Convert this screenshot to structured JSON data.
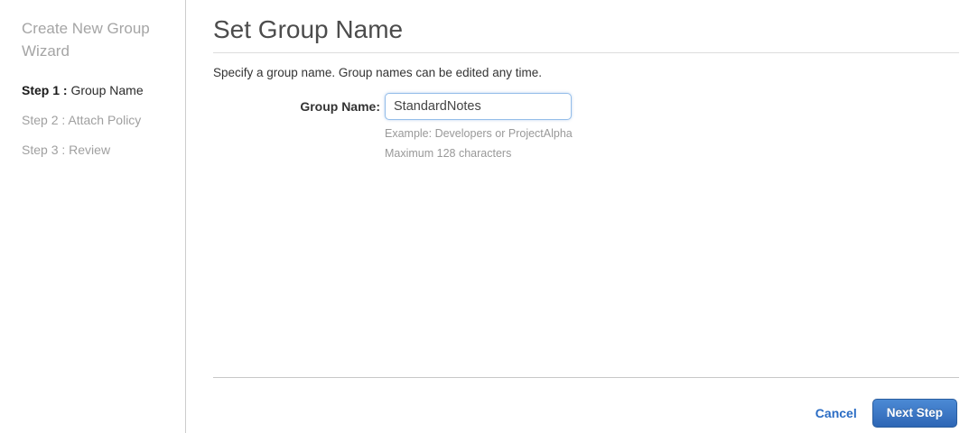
{
  "sidebar": {
    "title": "Create New Group Wizard",
    "steps": [
      {
        "prefix": "Step 1 :",
        "label": " Group Name",
        "active": true
      },
      {
        "prefix": "Step 2 :",
        "label": " Attach Policy",
        "active": false
      },
      {
        "prefix": "Step 3 :",
        "label": " Review",
        "active": false
      }
    ]
  },
  "main": {
    "title": "Set Group Name",
    "description": "Specify a group name. Group names can be edited any time.",
    "form": {
      "group_name_label": "Group Name:",
      "group_name_value": "StandardNotes",
      "hint_example": "Example: Developers or ProjectAlpha",
      "hint_max": "Maximum 128 characters"
    },
    "footer": {
      "cancel_label": "Cancel",
      "next_label": "Next Step"
    }
  },
  "colors": {
    "link_blue": "#2a6cc4",
    "button_gradient_top": "#4c8ad5",
    "button_gradient_bottom": "#2d66b5",
    "sidebar_divider": "#cccccc",
    "muted_text": "#999999"
  }
}
